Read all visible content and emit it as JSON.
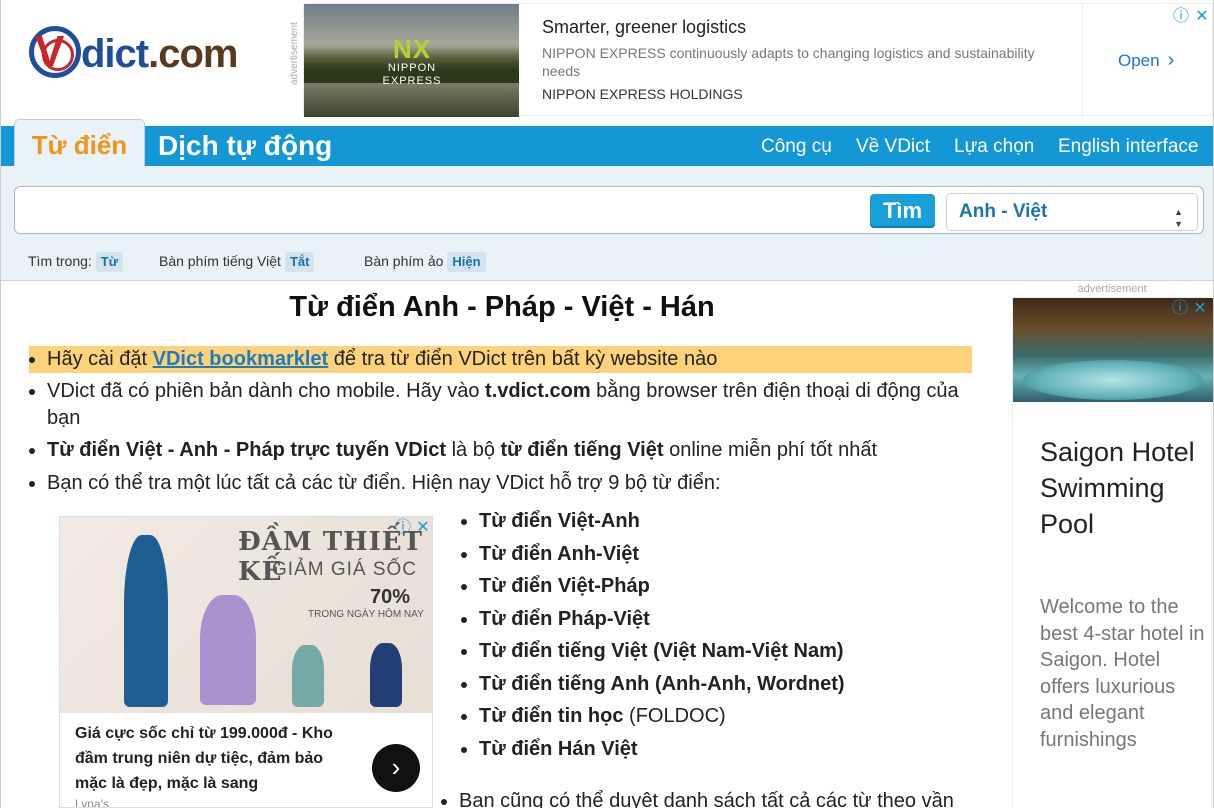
{
  "logo": {
    "v": "V",
    "dict": "dict",
    "com": ".com"
  },
  "ad_top": {
    "label": "advertisement",
    "brand_big": "NX",
    "brand_name1": "NIPPON",
    "brand_name2": "EXPRESS",
    "title": "Smarter, greener logistics",
    "desc": "NIPPON EXPRESS continuously adapts to changing logistics and sustainability needs",
    "advertiser": "NIPPON EXPRESS HOLDINGS",
    "cta": "Open",
    "cta_arrow": "›"
  },
  "nav": {
    "tab_dict": "Từ điển",
    "tab_auto": "Dịch tự động",
    "links": [
      "Công cụ",
      "Về VDict",
      "Lựa chọn",
      "English interface"
    ]
  },
  "search": {
    "value": "",
    "button": "Tìm",
    "lang": "Anh - Việt"
  },
  "options": {
    "search_in_label": "Tìm trong:",
    "search_in_value": "Từ",
    "keyboard_label": "Bàn phím tiếng Việt",
    "keyboard_value": "Tắt",
    "virtual_label": "Bàn phím ảo",
    "virtual_value": "Hiện"
  },
  "main": {
    "title": "Từ điển Anh - Pháp - Việt - Hán",
    "b1_pre": "Hãy cài đặt ",
    "b1_link": "VDict bookmarklet",
    "b1_post": " để tra từ điển VDict trên bất kỳ website nào",
    "b2_pre": "VDict đã có phiên bản dành cho mobile. Hãy vào ",
    "b2_bold": "t.vdict.com",
    "b2_post": " bằng browser trên điện thoại di động của bạn",
    "b3_bold1": "Từ điển Việt - Anh - Pháp trực tuyến VDict",
    "b3_mid": " là bộ ",
    "b3_bold2": "từ điển tiếng Việt",
    "b3_post": " online miễn phí tốt nhất",
    "b4": "Bạn có thể tra một lúc tất cả các từ điển. Hiện nay VDict hỗ trợ 9 bộ từ điển:",
    "dicts": [
      "Từ điển Việt-Anh",
      "Từ điển Anh-Việt",
      "Từ điển Việt-Pháp",
      "Từ điển Pháp-Việt",
      "Từ điển tiếng Việt (Việt Nam-Việt Nam)",
      "Từ điển tiếng Anh (Anh-Anh, Wordnet)",
      "Từ điển tin học",
      "Từ điển Hán Việt"
    ],
    "dict7_suffix": " (FOLDOC)",
    "b_last": "Bạn cũng có thể duyệt danh sách tất cả các từ theo vần"
  },
  "ad_mid": {
    "h1": "ĐẦM THIẾT KẾ",
    "h2": "GIẢM GIÁ SỐC",
    "h3": "70%",
    "h4": "TRONG NGÀY HÔM NAY",
    "caption": "Giá cực sốc chỉ từ 199.000đ - Kho đầm trung niên dự tiệc, đảm bảo mặc là đẹp, mặc là sang",
    "advertiser": "Lyna's",
    "arrow": "›"
  },
  "ad_right": {
    "label": "advertisement",
    "title": "Saigon Hotel Swimming Pool",
    "desc": "Welcome to the best 4-star hotel in Saigon. Hotel offers luxurious and elegant furnishings"
  },
  "colors": {
    "nav_blue": "#1498d5",
    "tab_orange": "#f29418",
    "highlight": "#fdd27b",
    "link": "#1d7bc0"
  }
}
